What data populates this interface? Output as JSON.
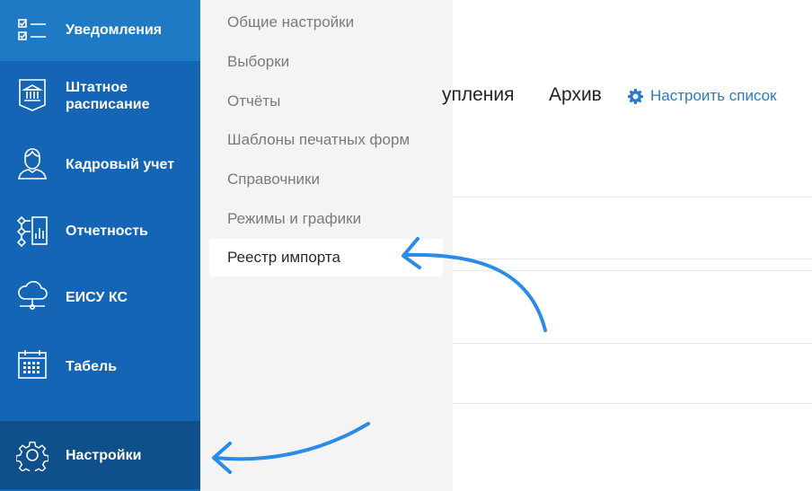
{
  "sidebar": {
    "items": [
      {
        "label_line1": "Уведомления",
        "label_line2": "",
        "icon": "checklist-icon"
      },
      {
        "label_line1": "Штатное",
        "label_line2": "расписание",
        "icon": "institution-icon"
      },
      {
        "label_line1": "Кадровый учет",
        "label_line2": "",
        "icon": "person-icon"
      },
      {
        "label_line1": "Отчетность",
        "label_line2": "",
        "icon": "report-icon"
      },
      {
        "label_line1": "ЕИСУ КС",
        "label_line2": "",
        "icon": "cloud-network-icon"
      },
      {
        "label_line1": "Табель",
        "label_line2": "",
        "icon": "calendar-icon"
      },
      {
        "label_line1": "Настройки",
        "label_line2": "",
        "icon": "gear-icon"
      }
    ]
  },
  "submenu": {
    "items": [
      "Общие настройки",
      "Выборки",
      "Отчёты",
      "Шаблоны печатных форм",
      "Справочники",
      "Режимы и графики",
      "Реестр импорта"
    ]
  },
  "main": {
    "tabs": [
      "упления",
      "Архив"
    ],
    "configure_label": "Настроить список"
  },
  "colors": {
    "sidebar": "#1565b6",
    "sidebar_top": "#1f7ac6",
    "sidebar_active": "#0f4f8c",
    "accent": "#2a7ac8",
    "arrow": "#2a8be8"
  }
}
